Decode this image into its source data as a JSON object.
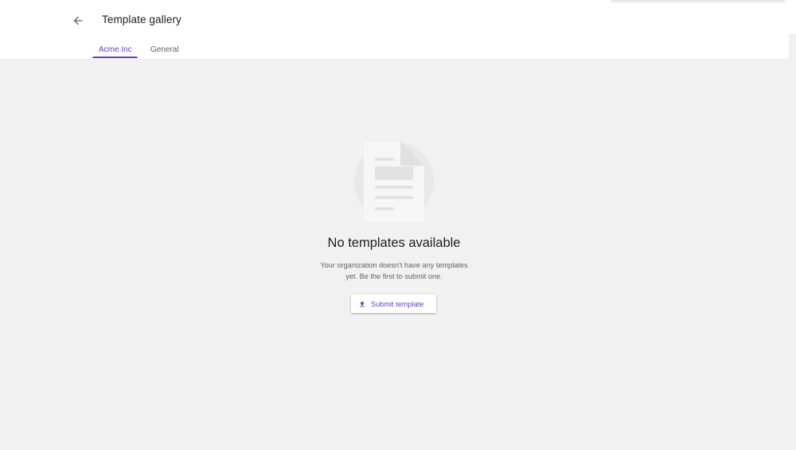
{
  "header": {
    "back_icon": "arrow-back-icon",
    "title": "Template gallery"
  },
  "tabs": [
    {
      "label": "Acme.Inc",
      "selected": true
    },
    {
      "label": "General",
      "selected": false
    }
  ],
  "empty_state": {
    "illustration_icon": "document-icon",
    "title": "No templates available",
    "description": "Your organization doesn't have any templates yet. Be the first to submit one.",
    "button": {
      "icon": "upload-icon",
      "label": "Submit template"
    }
  },
  "colors": {
    "accent": "#6a3cc2",
    "background": "#f1f1f1",
    "surface": "#ffffff",
    "text_primary": "#202124",
    "text_secondary": "#5f6368"
  }
}
